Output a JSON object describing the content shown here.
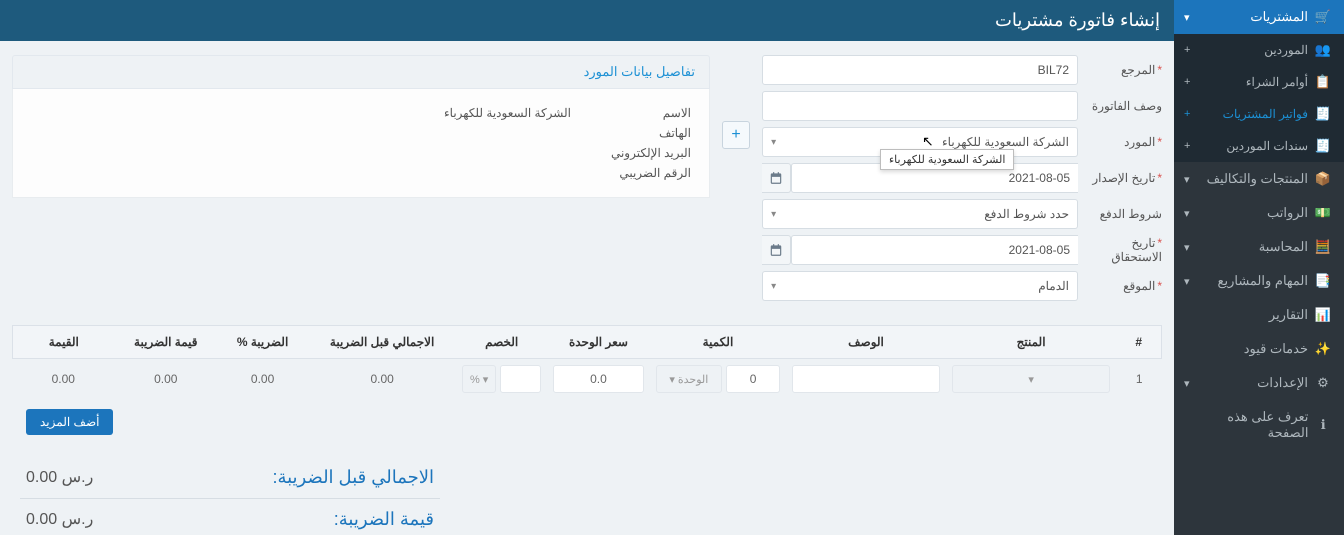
{
  "sidebar": {
    "purchases": {
      "label": "المشتريات"
    },
    "sub": {
      "vendors": {
        "label": "الموردين"
      },
      "orders": {
        "label": "أوامر الشراء"
      },
      "bills": {
        "label": "فواتير المشتريات"
      },
      "payments": {
        "label": "سندات الموردين"
      }
    },
    "products": {
      "label": "المنتجات والتكاليف"
    },
    "payroll": {
      "label": "الرواتب"
    },
    "accounting": {
      "label": "المحاسبة"
    },
    "tasks": {
      "label": "المهام والمشاريع"
    },
    "reports": {
      "label": "التقارير"
    },
    "journal": {
      "label": "خدمات قيود"
    },
    "settings": {
      "label": "الإعدادات"
    },
    "learn": {
      "label": "تعرف على هذه الصفحة"
    }
  },
  "header": {
    "title": "إنشاء فاتورة مشتريات"
  },
  "form": {
    "reference": {
      "label": "المرجع",
      "value": "BIL72"
    },
    "description": {
      "label": "وصف الفاتورة",
      "value": ""
    },
    "vendor": {
      "label": "المورد",
      "value": "الشركة السعودية للكهرباء"
    },
    "vendor_tooltip": "الشركة السعودية للكهرباء",
    "issue_date": {
      "label": "تاريخ الإصدار",
      "value": "2021-08-05"
    },
    "terms": {
      "label": "شروط الدفع",
      "value": "حدد شروط الدفع"
    },
    "due_date": {
      "label": "تاريخ الاستحقاق",
      "value": "2021-08-05"
    },
    "location": {
      "label": "الموقع",
      "value": "الدمام"
    }
  },
  "vendor_card": {
    "title": "تفاصيل بيانات المورد",
    "name_label": "الاسم",
    "name_value": "الشركة السعودية للكهرباء",
    "phone_label": "الهاتف",
    "email_label": "البريد الإلكتروني",
    "tax_label": "الرقم الضريبي"
  },
  "table": {
    "headers": {
      "num": "#",
      "product": "المنتج",
      "desc": "الوصف",
      "qty": "الكمية",
      "unit_price": "سعر الوحدة",
      "discount": "الخصم",
      "subtotal": "الاجمالي قبل الضريبة",
      "tax_pct": "الضريبة %",
      "tax_amt": "قيمة الضريبة",
      "total": "القيمة"
    },
    "row": {
      "num": "1",
      "product": "",
      "desc": "",
      "qty": "0",
      "unit_label": "الوحدة",
      "unit_price": "0.0",
      "discount": "",
      "discount_unit": "% ▾",
      "subtotal": "0.00",
      "tax_pct": "0.00",
      "tax_amt": "0.00",
      "total": "0.00"
    },
    "add_more": "أضف المزيد"
  },
  "totals": {
    "subtotal_label": "الاجمالي قبل الضريبة:",
    "subtotal_value": "0.00 ر.س",
    "tax_label": "قيمة الضريبة:",
    "tax_value": "0.00 ر.س"
  }
}
